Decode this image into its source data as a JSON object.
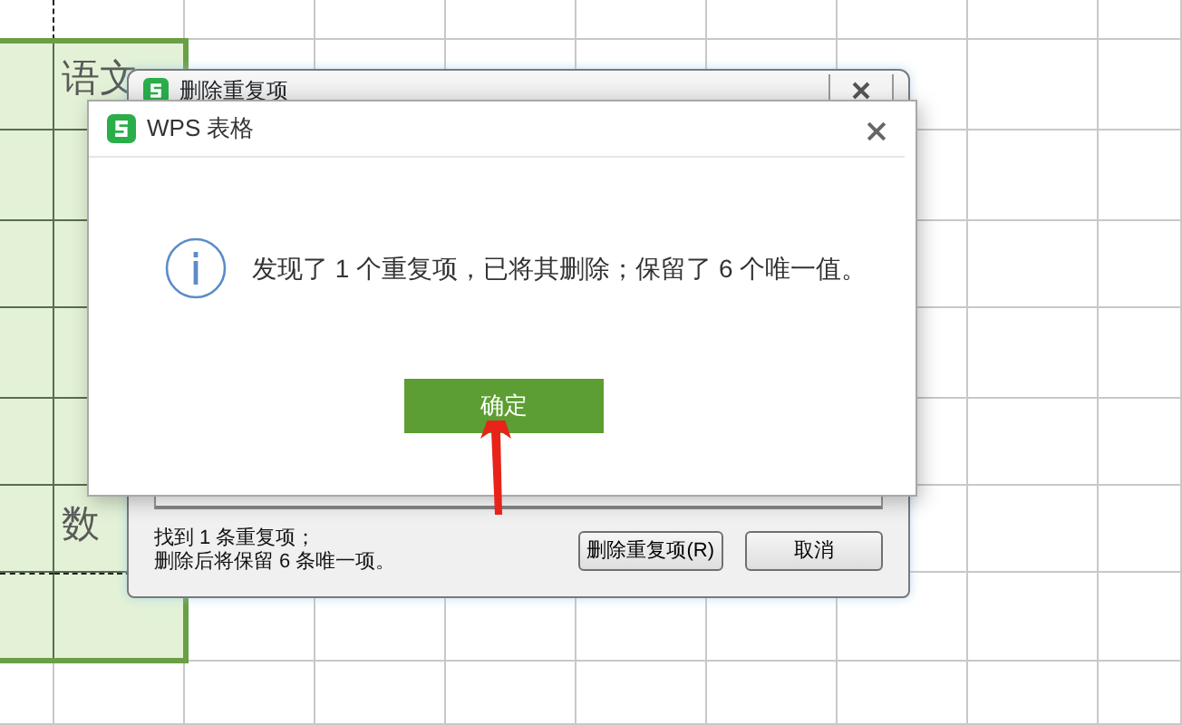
{
  "sheet": {
    "rows": [
      {
        "selected": false
      },
      {
        "selected": true,
        "column_2": "语文"
      },
      {
        "selected": true
      },
      {
        "selected": true
      },
      {
        "selected": true
      },
      {
        "selected": true
      },
      {
        "selected": true,
        "column_2": "数"
      },
      {
        "selected": true
      },
      {
        "selected": false
      }
    ]
  },
  "back_dialog": {
    "title": "删除重复项",
    "summary": [
      "找到 1 条重复项；",
      "删除后将保留 6 条唯一项。"
    ],
    "buttons": [
      "删除重复项(R)",
      "取消"
    ]
  },
  "dialog": {
    "title": "WPS 表格",
    "message": "发现了 1 个重复项，已将其删除；保留了 6 个唯一值。",
    "button": "确定"
  }
}
